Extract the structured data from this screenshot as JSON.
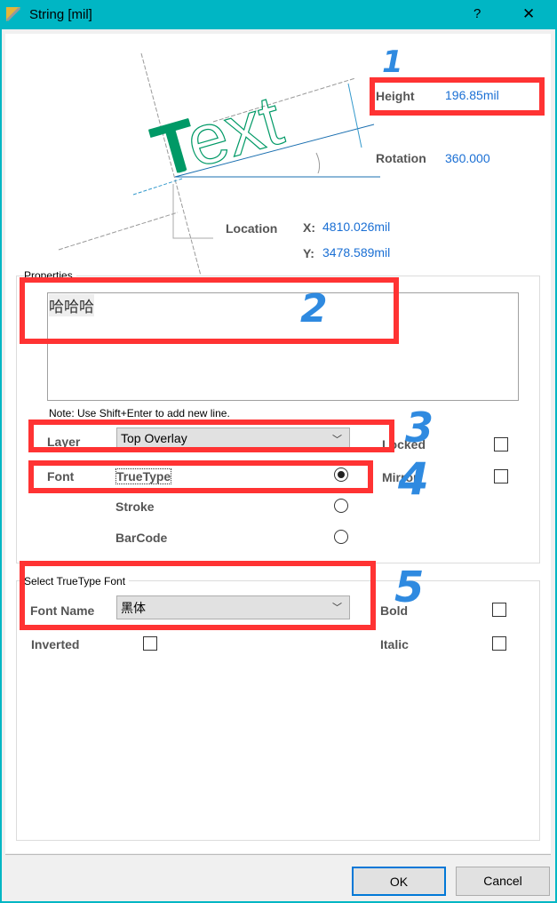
{
  "window": {
    "title": "String  [mil]",
    "help_label": "?",
    "close_label": "✕"
  },
  "preview": {
    "sample_text": "Text",
    "height_label": "Height",
    "height_value": "196.85mil",
    "rotation_label": "Rotation",
    "rotation_value": "360.000",
    "location_label": "Location",
    "x_label": "X:",
    "x_value": "4810.026mil",
    "y_label": "Y:",
    "y_value": "3478.589mil"
  },
  "properties": {
    "group_label": "Properties",
    "text_value": "哈哈哈",
    "note": "Note: Use Shift+Enter to add new line.",
    "layer_label": "Layer",
    "layer_value": "Top Overlay",
    "locked_label": "Locked",
    "font_label": "Font",
    "mirror_label": "Mirror",
    "font_options": [
      {
        "label": "TrueType",
        "selected": true
      },
      {
        "label": "Stroke",
        "selected": false
      },
      {
        "label": "BarCode",
        "selected": false
      }
    ],
    "locked": false,
    "mirror": false
  },
  "truetype": {
    "group_label": "Select TrueType Font",
    "font_name_label": "Font Name",
    "font_name_value": "黑体",
    "bold_label": "Bold",
    "inverted_label": "Inverted",
    "italic_label": "Italic",
    "bold": false,
    "inverted": false,
    "italic": false
  },
  "footer": {
    "ok_label": "OK",
    "cancel_label": "Cancel"
  },
  "annotations": {
    "numbers": [
      "1",
      "2",
      "3",
      "4",
      "5"
    ],
    "box_color": "#ff3333",
    "number_color": "#2f8ae0"
  },
  "colors": {
    "titlebar": "#00b6c4",
    "value_text": "#1a6fd4",
    "text_green": "#009966"
  }
}
